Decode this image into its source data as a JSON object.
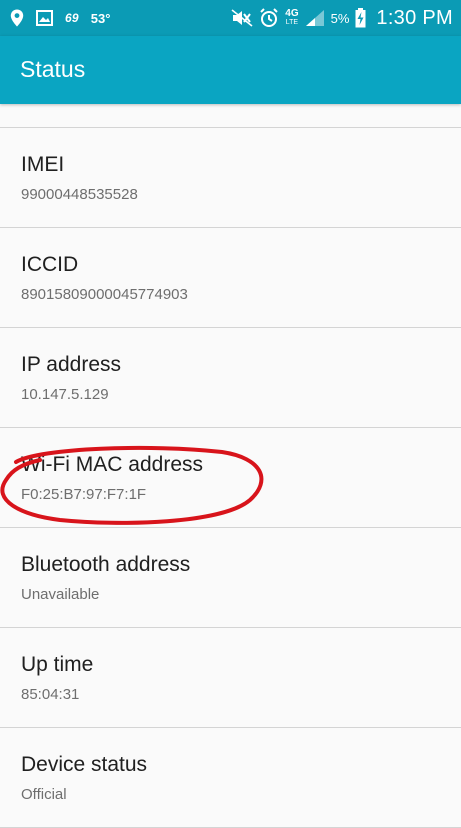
{
  "status_bar": {
    "signal_text": "69",
    "temperature": "53°",
    "network": "4G",
    "network_sub": "LTE",
    "battery": "5%",
    "time": "1:30 PM",
    "icons": [
      "location-icon",
      "image-icon",
      "mute-icon",
      "alarm-icon",
      "signal-icon",
      "battery-charging-icon"
    ]
  },
  "app_bar": {
    "title": "Status"
  },
  "items": [
    {
      "title": "IMEI",
      "value": "99000448535528"
    },
    {
      "title": "ICCID",
      "value": "89015809000045774903"
    },
    {
      "title": "IP address",
      "value": "10.147.5.129"
    },
    {
      "title": "Wi-Fi MAC address",
      "value": "F0:25:B7:97:F7:1F"
    },
    {
      "title": "Bluetooth address",
      "value": "Unavailable"
    },
    {
      "title": "Up time",
      "value": "85:04:31"
    },
    {
      "title": "Device status",
      "value": "Official"
    }
  ],
  "colors": {
    "status_bar": "#0b9bb5",
    "app_bar": "#0aa5c2",
    "annotation": "#d8141b"
  }
}
